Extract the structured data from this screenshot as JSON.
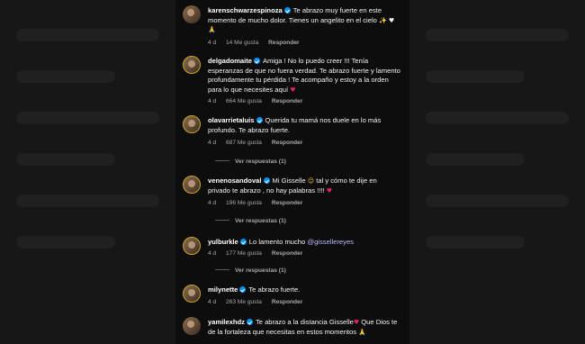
{
  "comments": [
    {
      "username": "karenschwarzespinoza",
      "text": "Te abrazo muy fuerte en este momento de mucho dolor. Tienes un angelito en el cielo",
      "emojis": "✨ ♥ 🙏",
      "age": "4 d",
      "likes": "14 Me gusta",
      "reply": "Responder"
    },
    {
      "username": "delgadomaite",
      "text": "Amiga ! No lo puedo creer !!! Tenía esperanzas de que no fuera verdad. Te abrazo fuerte y lamento profundamente tu pérdida ! Te acompaño y estoy a la orden para lo que necesites aquí",
      "emojis": "♥",
      "age": "4 d",
      "likes": "664 Me gusta",
      "reply": "Responder"
    },
    {
      "username": "olavarrietaluis",
      "text": "Querida tu mamá nos duele en lo más profundo. Te abrazo fuerte.",
      "age": "4 d",
      "likes": "687 Me gusta",
      "reply": "Responder",
      "view_replies": "Ver respuestas (1)"
    },
    {
      "username": "venenosandoval",
      "text": "Mi Gisselle",
      "text2": "tal y cómo te dije en privado te abrazo , no hay palabras !!!!",
      "emojis": "☺",
      "emojis2": "♥",
      "age": "4 d",
      "likes": "196 Me gusta",
      "reply": "Responder",
      "view_replies": "Ver respuestas (1)"
    },
    {
      "username": "yulburkle",
      "text": "Lo lamento mucho",
      "mention": "@gissellereyes",
      "age": "4 d",
      "likes": "177 Me gusta",
      "reply": "Responder",
      "view_replies": "Ver respuestas (1)"
    },
    {
      "username": "milynette",
      "text": "Te abrazo fuerte.",
      "age": "4 d",
      "likes": "263 Me gusta",
      "reply": "Responder"
    },
    {
      "username": "yamilexhdz",
      "text": "Te abrazo a la distancia Gisselle",
      "text2": "Que Dios te de la fortaleza que necesitas en estos momentos",
      "emojis": "♥",
      "emojis2": "🙏"
    }
  ]
}
